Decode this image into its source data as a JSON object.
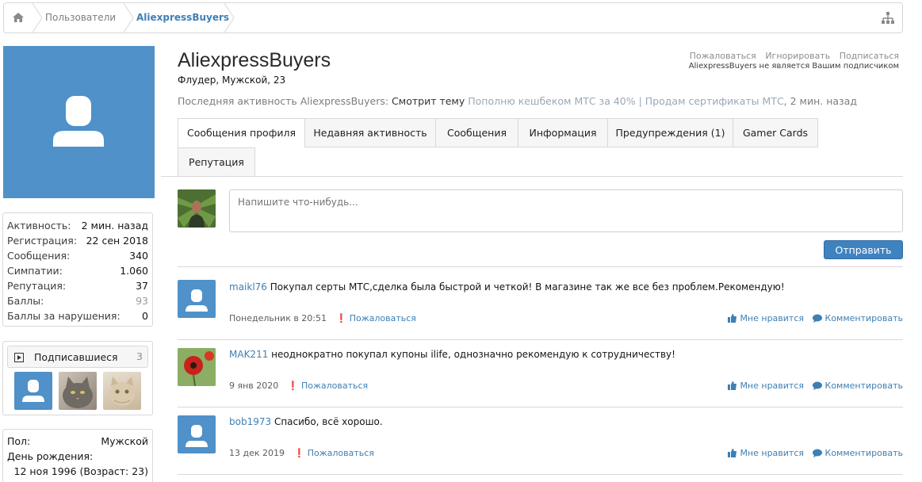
{
  "breadcrumb": {
    "home_icon": "home-icon",
    "items": [
      "Пользователи",
      "AliexpressBuyers"
    ],
    "sitemap_icon": "sitemap-icon"
  },
  "profile": {
    "username": "AliexpressBuyers",
    "title": "Флудер, Мужской, 23",
    "actions": [
      "Пожаловаться",
      "Игнорировать",
      "Подписаться"
    ],
    "follow_note": "AliexpressBuyers не является Вашим подписчиком",
    "last_activity": {
      "prefix": "Последняя активность AliexpressBuyers:",
      "action": "Смотрит тему",
      "thread": "Пополню кешбеком МТС за 40% | Продам сертификаты МТС",
      "time": ", 2 мин. назад"
    }
  },
  "sidebar": {
    "stats": [
      {
        "label": "Активность:",
        "value": "2 мин. назад"
      },
      {
        "label": "Регистрация:",
        "value": "22 сен 2018"
      },
      {
        "label": "Сообщения:",
        "value": "340"
      },
      {
        "label": "Симпатии:",
        "value": "1.060"
      },
      {
        "label": "Репутация:",
        "value": "37"
      },
      {
        "label": "Баллы:",
        "value": "93"
      },
      {
        "label": "Баллы за нарушения:",
        "value": "0"
      }
    ],
    "subscribers": {
      "title": "Подписавшиеся",
      "count": "3"
    },
    "info": {
      "gender_label": "Пол:",
      "gender": "Мужской",
      "birthday_label": "День рождения:",
      "birthday": "12 ноя 1996 (Возраст: 23)"
    }
  },
  "tabs": [
    "Сообщения профиля",
    "Недавняя активность",
    "Сообщения",
    "Информация",
    "Предупреждения (1)",
    "Gamer Cards",
    "Репутация"
  ],
  "composer": {
    "placeholder": "Напишите что-нибудь...",
    "submit": "Отправить"
  },
  "messages": [
    {
      "author": "maikl76",
      "text": "Покупал серты МТС,сделка была быстрой и четкой! В магазине так же все без проблем.Рекомендую!",
      "date": "Понедельник в 20:51",
      "report": "Пожаловаться",
      "like": "Мне нравится",
      "comment": "Комментировать"
    },
    {
      "author": "MAK211",
      "text": "неоднократно покупал купоны ilife, однозначно рекомендую к сотрудничеству!",
      "date": "9 янв 2020",
      "report": "Пожаловаться",
      "like": "Мне нравится",
      "comment": "Комментировать"
    },
    {
      "author": "bob1973",
      "text": "Спасибо, всё хорошо.",
      "date": "13 дек 2019",
      "report": "Пожаловаться",
      "like": "Мне нравится",
      "comment": "Комментировать"
    }
  ],
  "colors": {
    "accent": "#3e7fb4",
    "avatar_blue": "#4f91c8",
    "button": "#3f82c0"
  }
}
